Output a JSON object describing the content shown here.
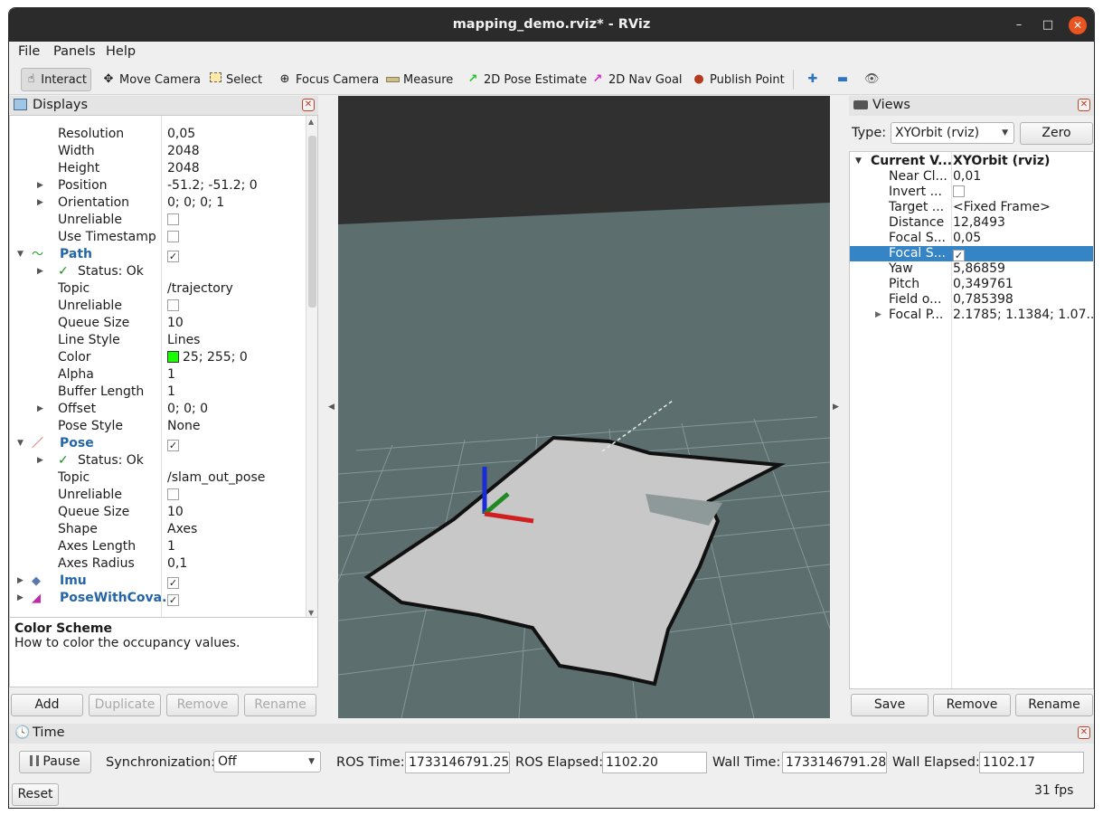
{
  "window": {
    "title": "mapping_demo.rviz* - RViz",
    "minimize": "–",
    "maximize": "□",
    "close": "✕"
  },
  "menu": [
    "File",
    "Panels",
    "Help"
  ],
  "toolbar": {
    "interact": "Interact",
    "move_camera": "Move Camera",
    "select": "Select",
    "focus_camera": "Focus Camera",
    "measure": "Measure",
    "pose_estimate": "2D Pose Estimate",
    "nav_goal": "2D Nav Goal",
    "publish_point": "Publish Point",
    "plus": "✚",
    "minus": "▬",
    "eye": "👁"
  },
  "displays": {
    "title": "Displays",
    "rows": [
      {
        "k": "Resolution",
        "v": "0,05"
      },
      {
        "k": "Width",
        "v": "2048"
      },
      {
        "k": "Height",
        "v": "2048"
      },
      {
        "k": "Position",
        "v": "-51.2; -51.2; 0"
      },
      {
        "k": "Orientation",
        "v": "0; 0; 0; 1"
      },
      {
        "k": "Unreliable",
        "v": ""
      },
      {
        "k": "Use Timestamp",
        "v": ""
      },
      {
        "k": "Path",
        "v": ""
      },
      {
        "k": "Status: Ok",
        "v": ""
      },
      {
        "k": "Topic",
        "v": "/trajectory"
      },
      {
        "k": "Unreliable",
        "v": ""
      },
      {
        "k": "Queue Size",
        "v": "10"
      },
      {
        "k": "Line Style",
        "v": "Lines"
      },
      {
        "k": "Color",
        "v": "25; 255; 0"
      },
      {
        "k": "Alpha",
        "v": "1"
      },
      {
        "k": "Buffer Length",
        "v": "1"
      },
      {
        "k": "Offset",
        "v": "0; 0; 0"
      },
      {
        "k": "Pose Style",
        "v": "None"
      },
      {
        "k": "Pose",
        "v": ""
      },
      {
        "k": "Status: Ok",
        "v": ""
      },
      {
        "k": "Topic",
        "v": "/slam_out_pose"
      },
      {
        "k": "Unreliable",
        "v": ""
      },
      {
        "k": "Queue Size",
        "v": "10"
      },
      {
        "k": "Shape",
        "v": "Axes"
      },
      {
        "k": "Axes Length",
        "v": "1"
      },
      {
        "k": "Axes Radius",
        "v": "0,1"
      },
      {
        "k": "Imu",
        "v": ""
      },
      {
        "k": "PoseWithCova...",
        "v": ""
      }
    ],
    "help_title": "Color Scheme",
    "help_text": "How to color the occupancy values.",
    "buttons": {
      "add": "Add",
      "duplicate": "Duplicate",
      "remove": "Remove",
      "rename": "Rename"
    }
  },
  "views": {
    "title": "Views",
    "type_label": "Type:",
    "type_value": "XYOrbit (rviz)",
    "zero": "Zero",
    "rows": [
      {
        "k": "Current V...",
        "v": "XYOrbit (rviz)"
      },
      {
        "k": "Near Cl...",
        "v": "0,01"
      },
      {
        "k": "Invert ...",
        "v": ""
      },
      {
        "k": "Target ...",
        "v": "<Fixed Frame>"
      },
      {
        "k": "Distance",
        "v": "12,8493"
      },
      {
        "k": "Focal S...",
        "v": "0,05"
      },
      {
        "k": "Focal S...",
        "v": ""
      },
      {
        "k": "Yaw",
        "v": "5,86859"
      },
      {
        "k": "Pitch",
        "v": "0,349761"
      },
      {
        "k": "Field o...",
        "v": "0,785398"
      },
      {
        "k": "Focal P...",
        "v": "2.1785; 1.1384; 1.07..."
      }
    ],
    "buttons": {
      "save": "Save",
      "remove": "Remove",
      "rename": "Rename"
    }
  },
  "time": {
    "title": "Time",
    "pause": "Pause",
    "sync_label": "Synchronization:",
    "sync_value": "Off",
    "ros_time_label": "ROS Time:",
    "ros_time": "1733146791.25",
    "ros_elapsed_label": "ROS Elapsed:",
    "ros_elapsed": "1102.20",
    "wall_time_label": "Wall Time:",
    "wall_time": "1733146791.28",
    "wall_elapsed_label": "Wall Elapsed:",
    "wall_elapsed": "1102.17",
    "reset": "Reset",
    "fps": "31 fps"
  },
  "colors": {
    "path_color": "#19ff00",
    "accent": "#3584c6",
    "close": "#e95420"
  }
}
